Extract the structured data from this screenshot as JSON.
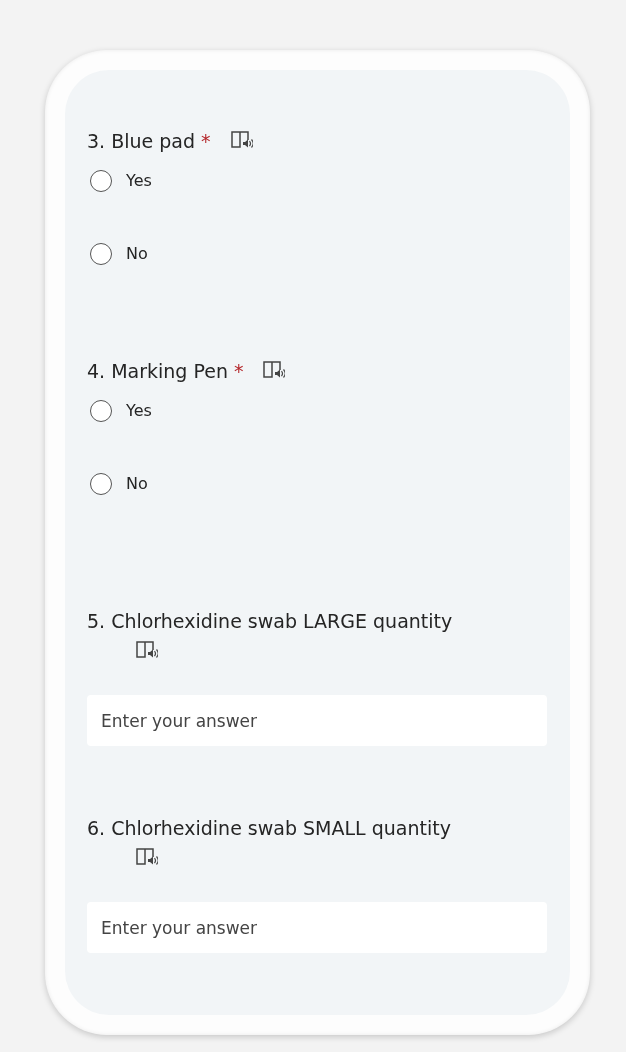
{
  "questions": [
    {
      "kind": "choice",
      "number": "3.",
      "title": "Blue pad",
      "required_mark": "*",
      "options": [
        {
          "label": "Yes",
          "selected": false
        },
        {
          "label": "No",
          "selected": false
        }
      ]
    },
    {
      "kind": "choice",
      "number": "4.",
      "title": "Marking Pen",
      "required_mark": "*",
      "options": [
        {
          "label": "Yes",
          "selected": false
        },
        {
          "label": "No",
          "selected": false
        }
      ]
    },
    {
      "kind": "text",
      "number": "5.",
      "title": "Chlorhexidine swab LARGE quantity",
      "placeholder": "Enter your answer"
    },
    {
      "kind": "text",
      "number": "6.",
      "title": "Chlorhexidine swab SMALL quantity",
      "placeholder": "Enter your answer"
    }
  ]
}
